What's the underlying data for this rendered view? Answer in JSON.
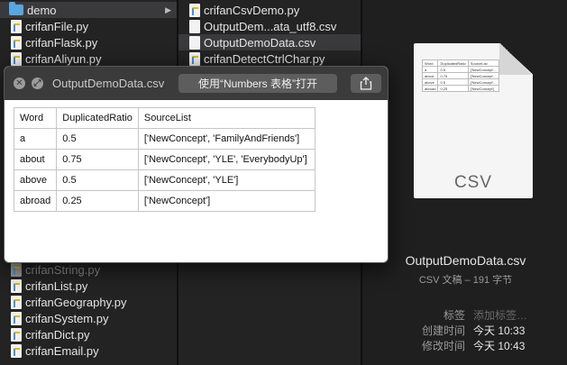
{
  "column1": {
    "items": [
      {
        "label": "demo",
        "type": "folder",
        "selected": true
      },
      {
        "label": "crifanFile.py",
        "type": "py"
      },
      {
        "label": "crifanFlask.py",
        "type": "py"
      },
      {
        "label": "crifanAliyun.py",
        "type": "py"
      },
      {
        "label": "crifanString.py",
        "type": "py",
        "dim": true
      },
      {
        "label": "crifanList.py",
        "type": "py"
      },
      {
        "label": "crifanGeography.py",
        "type": "py"
      },
      {
        "label": "crifanSystem.py",
        "type": "py"
      },
      {
        "label": "crifanDict.py",
        "type": "py"
      },
      {
        "label": "crifanEmail.py",
        "type": "py"
      }
    ]
  },
  "column2": {
    "items": [
      {
        "label": "crifanCsvDemo.py",
        "type": "py"
      },
      {
        "label": "OutputDem...ata_utf8.csv",
        "type": "csv"
      },
      {
        "label": "OutputDemoData.csv",
        "type": "csv",
        "selected": true
      },
      {
        "label": "crifanDetectCtrlChar.py",
        "type": "py"
      }
    ]
  },
  "quicklook": {
    "title": "OutputDemoData.csv",
    "open_label": "使用“Numbers 表格”打开",
    "table": {
      "headers": [
        "Word",
        "DuplicatedRatio",
        "SourceList"
      ],
      "rows": [
        [
          "a",
          "0.5",
          "['NewConcept', 'FamilyAndFriends']"
        ],
        [
          "about",
          "0.75",
          "['NewConcept', 'YLE', 'EverybodyUp']"
        ],
        [
          "above",
          "0.5",
          "['NewConcept', 'YLE']"
        ],
        [
          "abroad",
          "0.25",
          "['NewConcept']"
        ]
      ]
    }
  },
  "preview": {
    "icon_ext": "CSV",
    "thumb_rows": [
      [
        "Word",
        "DuplicatedRatio",
        "SourceList"
      ],
      [
        "a",
        "0.5",
        "['NewConcept'..."
      ],
      [
        "about",
        "0.75",
        "['NewConcept'..."
      ],
      [
        "above",
        "0.5",
        "['NewConcept'..."
      ],
      [
        "abroad",
        "0.25",
        "['NewConcept']"
      ]
    ],
    "filename": "OutputDemoData.csv",
    "kind": "CSV 文稿 – 191 字节",
    "tags_label": "标签",
    "tags_placeholder": "添加标签…",
    "created_label": "创建时间",
    "created_value": "今天 10:33",
    "modified_label": "修改时间",
    "modified_value": "今天 10:43"
  },
  "colors": {
    "folder": "#5aa6e0",
    "selection": "#3a3a3c",
    "window_bar": "#3b3b3b"
  }
}
